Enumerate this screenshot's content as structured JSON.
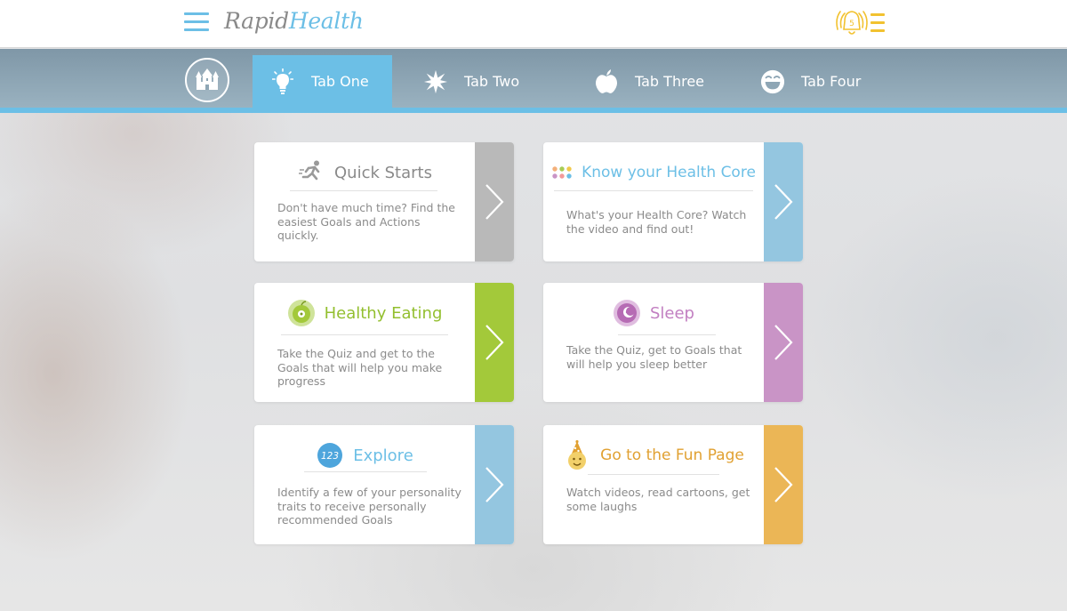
{
  "app": {
    "logo_part1": "Rapid",
    "logo_part2": "Health",
    "notification_count": "5"
  },
  "nav": {
    "tabs": [
      {
        "label": "Tab One",
        "icon": "lightbulb-icon",
        "active": true
      },
      {
        "label": "Tab Two",
        "icon": "star-burst-icon",
        "active": false
      },
      {
        "label": "Tab Three",
        "icon": "apple-icon",
        "active": false
      },
      {
        "label": "Tab Four",
        "icon": "smiley-icon",
        "active": false
      }
    ]
  },
  "cards": [
    {
      "title": "Quick Starts",
      "description": "Don't have much time? Find the easiest Goals and Actions quickly.",
      "icon": "runner-icon",
      "accent": "#b9b9b9",
      "title_color": "#8a8a8a"
    },
    {
      "title": "Know your Health Core",
      "description": "What's your Health Core? Watch the video and find out!",
      "icon": "dots-icon",
      "accent": "#94c6e0",
      "title_color": "#6cbfe6"
    },
    {
      "title": "Healthy Eating",
      "description": "Take the Quiz and get to the Goals that will help you make progress",
      "icon": "apple-face-icon",
      "accent": "#a3c93a",
      "title_color": "#93bf2f"
    },
    {
      "title": "Sleep",
      "description": "Take the Quiz, get to Goals that will help you sleep better",
      "icon": "sleep-moon-icon",
      "accent": "#c994c6",
      "title_color": "#c27fc1"
    },
    {
      "title": "Explore",
      "description": "Identify a few of your personality traits to receive personally recommended Goals",
      "icon": "numbers-123-icon",
      "badge_text": "123",
      "accent": "#94c6e0",
      "title_color": "#6cbfe6"
    },
    {
      "title": "Go to the Fun Page",
      "description": "Watch videos, read cartoons, get some laughs",
      "icon": "party-hat-icon",
      "accent": "#ebb656",
      "title_color": "#e1a132"
    }
  ],
  "colors": {
    "brand_blue": "#6cbfe6",
    "logo_gray": "#8a8a8a",
    "alert_yellow": "#f2c230",
    "nav_bar": "#8ea6b5"
  }
}
